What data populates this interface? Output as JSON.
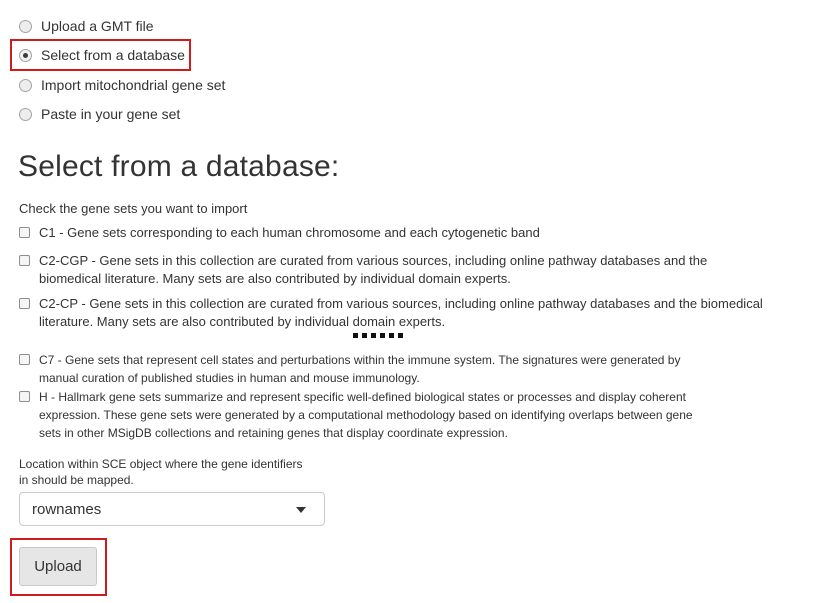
{
  "source_options": [
    {
      "label": "Upload a GMT file",
      "selected": false
    },
    {
      "label": "Select from a database",
      "selected": true
    },
    {
      "label": "Import mitochondrial gene set",
      "selected": false
    },
    {
      "label": "Paste in your gene set",
      "selected": false
    }
  ],
  "section_title": "Select from a database:",
  "instructions": "Check the gene sets you want to import",
  "gene_sets": [
    {
      "line1": "C1 - Gene sets corresponding to each human chromosome and each cytogenetic band",
      "line2": "",
      "line3": "",
      "checked": false
    },
    {
      "line1": "C2-CGP - Gene sets in this collection are curated from various sources, including online pathway databases and the",
      "line2": "biomedical literature. Many sets are also contributed by individual domain experts.",
      "line3": "",
      "checked": false
    },
    {
      "line1": "C2-CP - Gene sets in this collection are curated from various sources, including online pathway databases and the biomedical",
      "line2": "literature. Many sets are also contributed by individual domain experts.",
      "line3": "",
      "checked": false
    },
    {
      "line1": "C7 - Gene sets that represent cell states and perturbations within the immune system. The signatures were generated by",
      "line2": "manual curation of published studies in human and mouse immunology.",
      "line3": "",
      "checked": false
    },
    {
      "line1": "H - Hallmark gene sets summarize and represent specific well-defined biological states or processes and display coherent",
      "line2": "expression. These gene sets were generated by a computational methodology based on identifying overlaps between gene",
      "line3": "sets in other MSigDB collections and retaining genes that display coordinate expression.",
      "checked": false
    }
  ],
  "location": {
    "label_line1": "Location within SCE object where the gene identifiers",
    "label_line2": "in should be mapped.",
    "selected": "rownames"
  },
  "upload_button": "Upload",
  "colors": {
    "highlight": "#d11a1a",
    "text": "#333333"
  }
}
